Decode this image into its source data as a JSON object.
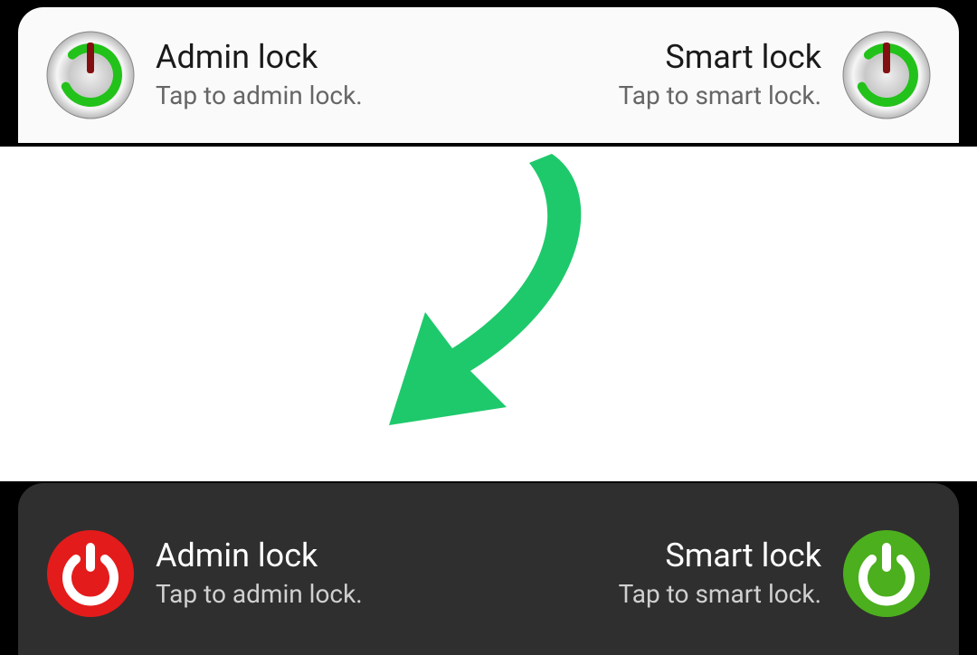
{
  "before": {
    "admin": {
      "title": "Admin lock",
      "subtitle": "Tap to admin lock."
    },
    "smart": {
      "title": "Smart lock",
      "subtitle": "Tap to smart lock."
    }
  },
  "after": {
    "admin": {
      "title": "Admin lock",
      "subtitle": "Tap to admin lock."
    },
    "smart": {
      "title": "Smart lock",
      "subtitle": "Tap to smart lock."
    }
  },
  "colors": {
    "arrow": "#1ec96b",
    "red": "#e41b1b",
    "green": "#4caf1e"
  }
}
